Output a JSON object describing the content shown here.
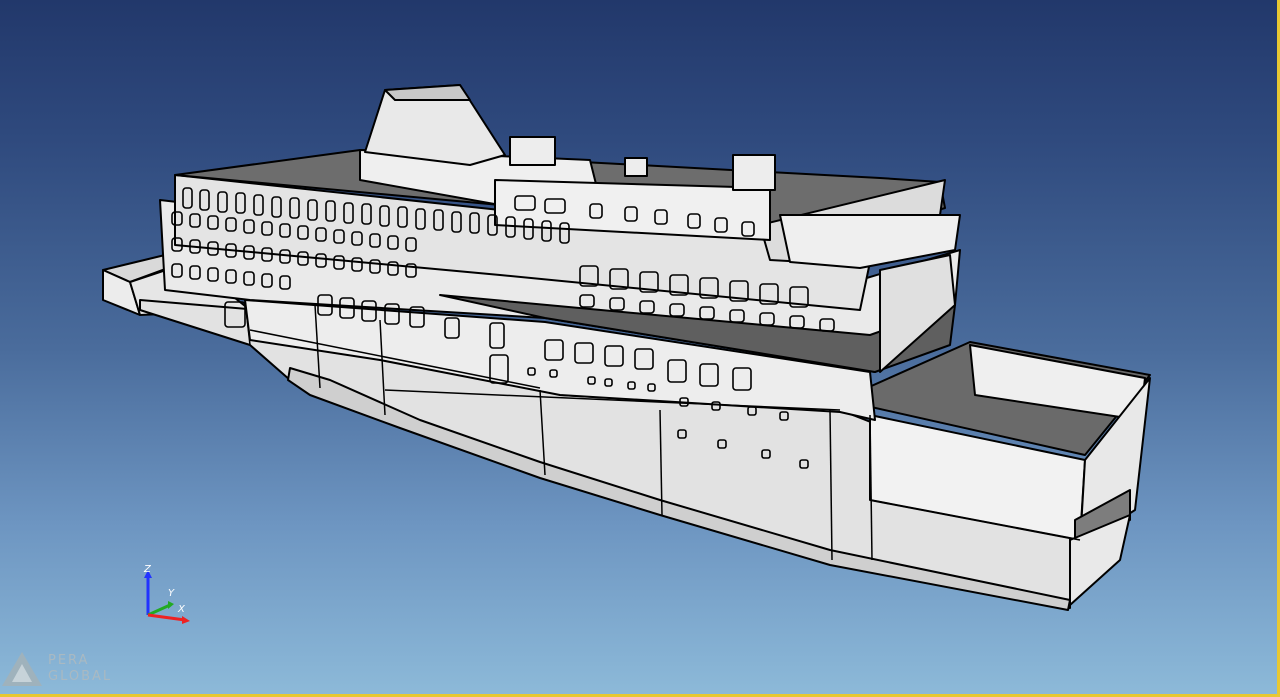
{
  "viewer": {
    "model_name": "ship-hull-model",
    "background_top": "#22386b",
    "background_bottom": "#8dbad9",
    "frame_color": "#e8c832"
  },
  "triad": {
    "z_label": "Z",
    "y_label": "Y",
    "x_label": "X",
    "z_color": "#2233ff",
    "y_color": "#22aa22",
    "x_color": "#ee2222"
  },
  "logo": {
    "line1": "PERA",
    "line2": "GLOBAL",
    "icon": "pera-global-logo-icon"
  }
}
